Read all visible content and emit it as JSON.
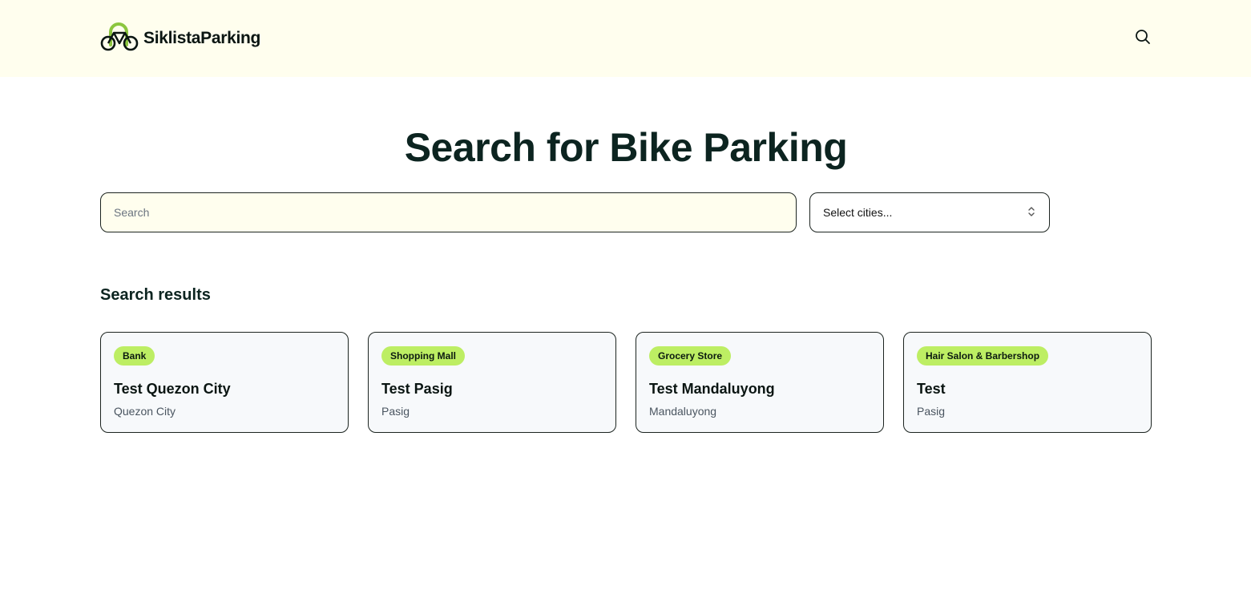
{
  "header": {
    "brand_name": "SiklistaParking",
    "logo_icon": "bicycle-logo-icon",
    "search_icon": "search-icon"
  },
  "main": {
    "title": "Search for Bike Parking",
    "search": {
      "placeholder": "Search",
      "value": ""
    },
    "city_select": {
      "label": "Select cities...",
      "icon": "chevron-up-down-icon"
    },
    "results_heading": "Search results",
    "results": [
      {
        "category": "Bank",
        "name": "Test Quezon City",
        "city": "Quezon City"
      },
      {
        "category": "Shopping Mall",
        "name": "Test Pasig",
        "city": "Pasig"
      },
      {
        "category": "Grocery Store",
        "name": "Test Mandaluyong",
        "city": "Mandaluyong"
      },
      {
        "category": "Hair Salon & Barbershop",
        "name": "Test",
        "city": "Pasig"
      }
    ]
  },
  "colors": {
    "header_bg": "#fffeee",
    "badge_bg": "#bdee63",
    "logo_green": "#8cc63f",
    "text_dark": "#0c2420"
  }
}
